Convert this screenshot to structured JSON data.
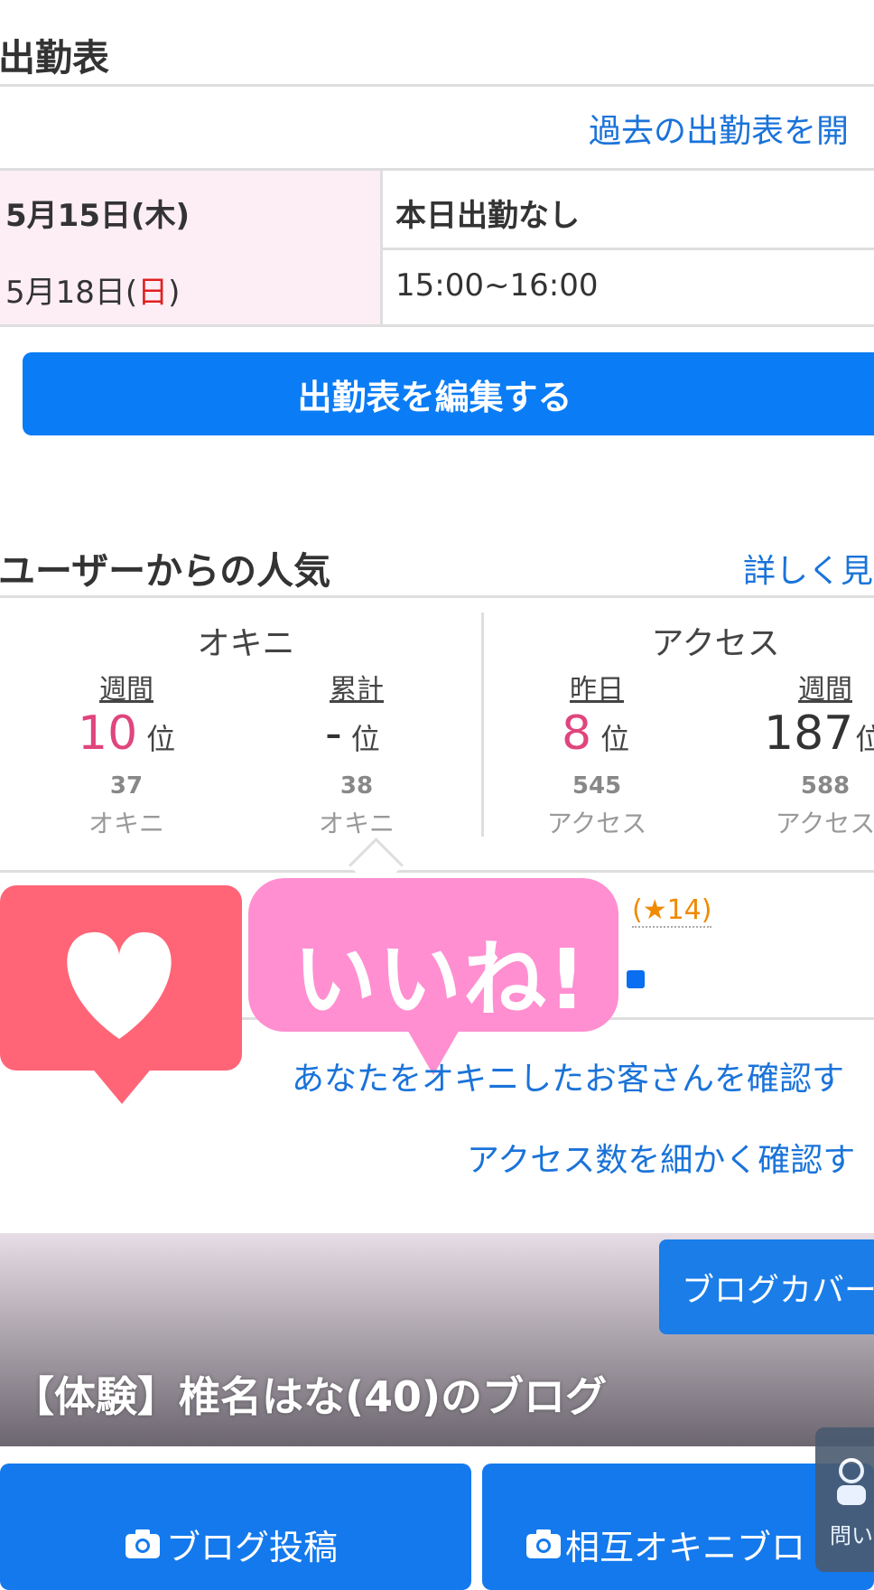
{
  "schedule": {
    "title": "出勤表",
    "past_link": "過去の出勤表を開",
    "rows": [
      {
        "date": "5月15日(木)",
        "value": "本日出勤なし"
      },
      {
        "date_prefix": "5月18日(",
        "weekday": "日",
        "date_suffix": ")",
        "value": "15:00~16:00"
      }
    ],
    "edit_button": "出勤表を編集する"
  },
  "popularity": {
    "title": "ユーザーからの人気",
    "detail_link": "詳しく見",
    "okini": {
      "label": "オキニ",
      "weekly": {
        "label": "週間",
        "rank": "10",
        "unit": "位",
        "count": "37",
        "count_label": "オキニ"
      },
      "total": {
        "label": "累計",
        "rank": "-",
        "unit": "位",
        "count": "38",
        "count_label": "オキニ"
      }
    },
    "access": {
      "label": "アクセス",
      "yesterday": {
        "label": "昨日",
        "rank": "8",
        "unit": "位",
        "count": "545",
        "count_label": "アクセス"
      },
      "weekly": {
        "label": "週間",
        "rank": "187",
        "unit": "位",
        "count": "588",
        "count_label": "アクセス"
      }
    },
    "star_count": "(★14)",
    "check_okini_link": "あなたをオキニしたお客さんを確認す",
    "check_access_link": "アクセス数を細かく確認す"
  },
  "overlay": {
    "iine": "いいね!",
    "colors": {
      "heart": "#ff6577",
      "iine": "#ff8fd0"
    }
  },
  "blog": {
    "cover_button": "ブログカバー",
    "title": "【体験】椎名はな(40)のブログ",
    "post_button": "ブログ投稿",
    "mutual_button": "相互オキニブロ"
  },
  "help": {
    "label": "問い"
  },
  "colors": {
    "accent": "#0a7cf5",
    "link": "#1a73d9",
    "rank_pink": "#e0457d",
    "date_bg": "#fdeef5"
  }
}
